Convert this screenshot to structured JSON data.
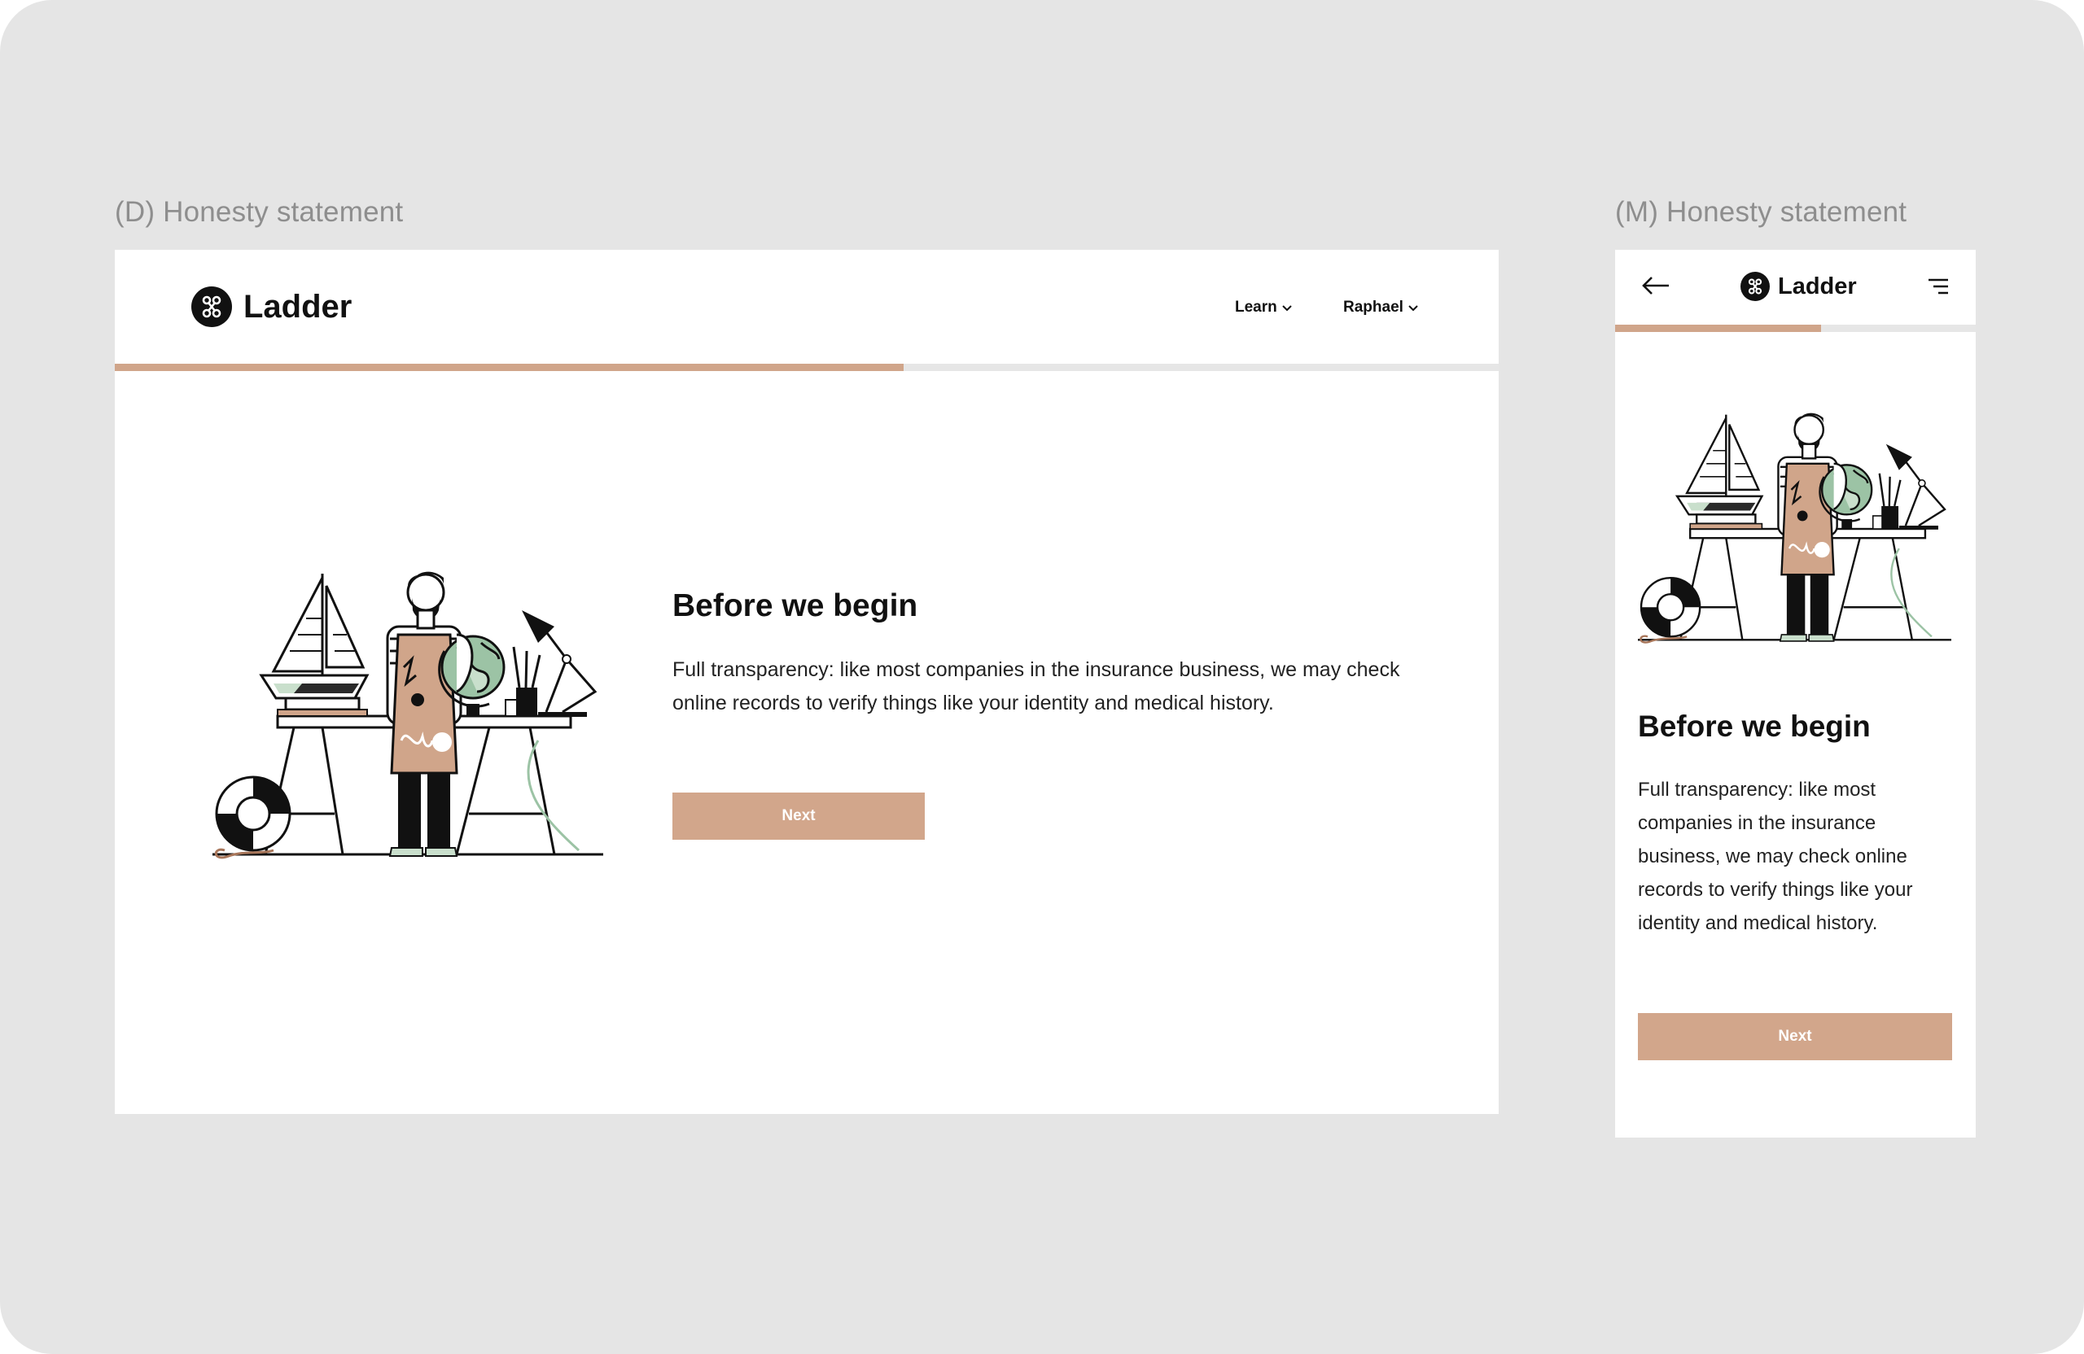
{
  "colors": {
    "canvas": "#e5e5e5",
    "accent": "#d2a68b",
    "progress_track": "#e6e6e6",
    "text": "#111111",
    "label": "#8e8e8e"
  },
  "desktop": {
    "frame_label": "(D) Honesty statement",
    "brand": "Ladder",
    "nav": [
      {
        "label": "Learn",
        "icon": "chevron-down-icon"
      },
      {
        "label": "Raphael",
        "icon": "chevron-down-icon"
      }
    ],
    "progress": 0.57,
    "heading": "Before we begin",
    "body": "Full transparency: like most companies in the insurance business, we may check online records to verify things like your identity and medical history.",
    "button": "Next",
    "illustration": "craftsman-at-workbench-illustration"
  },
  "mobile": {
    "frame_label": "(M) Honesty statement",
    "brand": "Ladder",
    "back_icon": "arrow-left-icon",
    "menu_icon": "menu-icon",
    "progress": 0.57,
    "heading": "Before we begin",
    "body": "Full transparency: like most companies in the insurance business, we may check online records to verify things like your identity and medical history.",
    "button": "Next",
    "illustration": "craftsman-at-workbench-illustration"
  }
}
